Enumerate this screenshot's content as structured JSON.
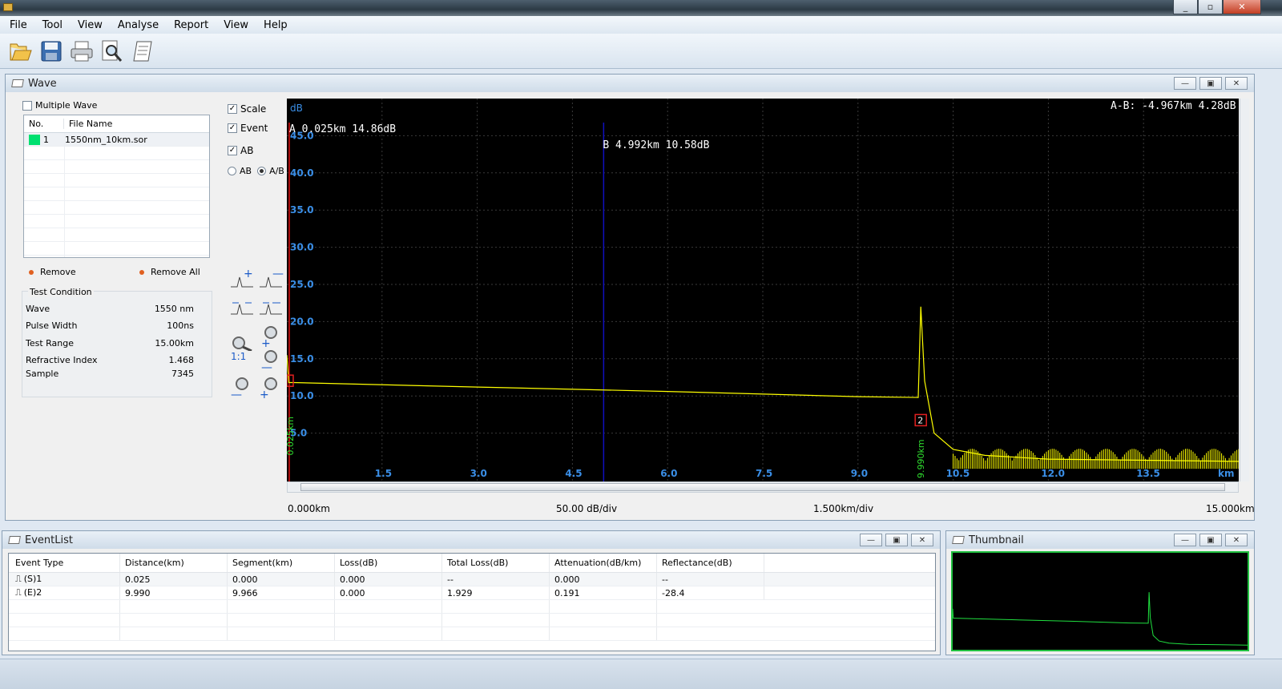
{
  "menu": [
    "File",
    "Tool",
    "View",
    "Analyse",
    "Report",
    "View",
    "Help"
  ],
  "toolbar": {
    "icons": [
      "open-folder-icon",
      "save-icon",
      "print-icon",
      "print-preview-icon",
      "report-icon"
    ]
  },
  "wave_panel": {
    "title": "Wave",
    "multiple_wave": "Multiple Wave",
    "file_columns": [
      "No.",
      "File Name"
    ],
    "files": [
      {
        "no": "1",
        "name": "1550nm_10km.sor",
        "color": "#00e070"
      }
    ],
    "remove": "Remove",
    "remove_all": "Remove All",
    "test_condition": {
      "title": "Test Condition",
      "rows": [
        {
          "label": "Wave",
          "value": "1550 nm"
        },
        {
          "label": "Pulse Width",
          "value": "100ns"
        },
        {
          "label": "Test Range",
          "value": "15.00km"
        },
        {
          "label": "Refractive Index",
          "value": "1.468"
        },
        {
          "label": "Sample",
          "value": "7345"
        }
      ]
    },
    "options": {
      "scale": "Scale",
      "event": "Event",
      "ab": "AB",
      "radio_ab": "AB",
      "radio_a_b": "A/B",
      "selected_radio": "A/B"
    },
    "zoom_labels": {
      "one_to_one": "1:1"
    }
  },
  "chart_data": {
    "type": "line",
    "ylabel": "dB",
    "xlabel": "km",
    "xlim": [
      0,
      15
    ],
    "ylim": [
      0,
      50
    ],
    "y_ticks": [
      "45.0",
      "40.0",
      "35.0",
      "30.0",
      "25.0",
      "20.0",
      "15.0",
      "10.0",
      "5.0"
    ],
    "x_ticks": [
      "1.5",
      "3.0",
      "4.5",
      "6.0",
      "7.5",
      "9.0",
      "10.5",
      "12.0",
      "13.5"
    ],
    "series": [
      {
        "color": "#ffff00",
        "x": [
          0.0,
          0.03,
          0.1,
          3.0,
          6.0,
          9.0,
          9.95,
          9.99,
          10.05,
          10.2,
          10.5,
          11.0,
          12.0,
          15.0
        ],
        "y": [
          15.5,
          11.8,
          11.8,
          11.2,
          10.6,
          9.9,
          9.8,
          22.0,
          12.0,
          5.0,
          2.8,
          2.0,
          1.5,
          1.2
        ]
      }
    ],
    "marker_a": {
      "x": 0.025,
      "label": "A 0.025km 14.86dB"
    },
    "marker_b": {
      "x": 4.992,
      "label": "B 4.992km 10.58dB"
    },
    "ab_diff": "A-B: -4.967km 4.28dB",
    "events": [
      {
        "id": "2",
        "x": 9.99,
        "label": "9.990km"
      }
    ],
    "marker_a_vertical_label": "0.025km"
  },
  "footer": {
    "start": "0.000km",
    "ydiv": "50.00 dB/div",
    "xdiv": "1.500km/div",
    "end": "15.000km"
  },
  "event_list": {
    "title": "EventList",
    "columns": [
      "Event Type",
      "Distance(km)",
      "Segment(km)",
      "Loss(dB)",
      "Total Loss(dB)",
      "Attenuation(dB/km)",
      "Reflectance(dB)"
    ],
    "rows": [
      [
        "(S)1",
        "0.025",
        "0.000",
        "0.000",
        "--",
        "0.000",
        "--"
      ],
      [
        "(E)2",
        "9.990",
        "9.966",
        "0.000",
        "1.929",
        "0.191",
        "-28.4"
      ]
    ]
  },
  "thumbnail": {
    "title": "Thumbnail",
    "trace_color": "#20e040"
  }
}
